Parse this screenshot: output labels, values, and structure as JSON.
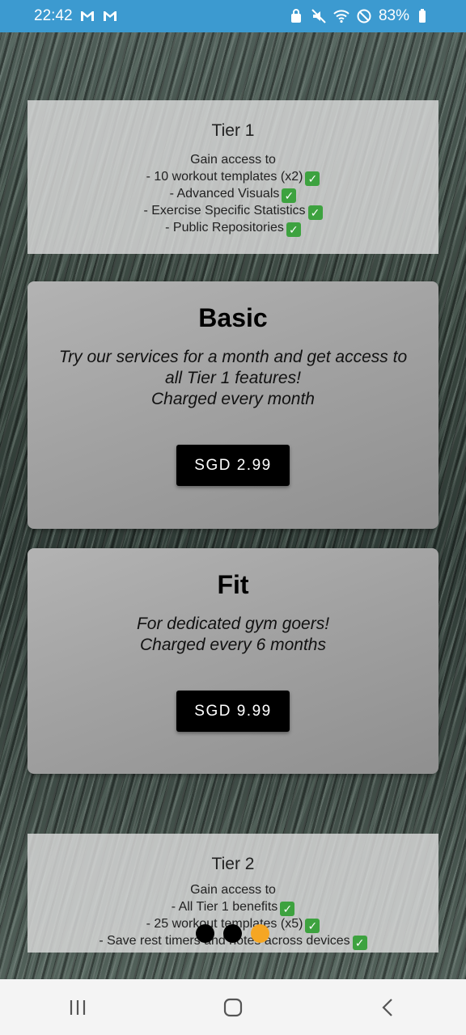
{
  "status_bar": {
    "time": "22:42",
    "battery": "83%",
    "left_icons": [
      "gmail-icon",
      "gmail-icon"
    ],
    "right_icons": [
      "lock-icon",
      "mute-icon",
      "wifi-icon",
      "dnd-icon",
      "battery-icon"
    ]
  },
  "tier1": {
    "title": "Tier 1",
    "lines": [
      "Gain access to",
      "- 10 workout templates (x2)",
      "- Advanced Visuals",
      "- Exercise Specific Statistics",
      "- Public Repositories"
    ]
  },
  "plans": [
    {
      "title": "Basic",
      "desc_lines": [
        "Try our services for a month and get access to",
        "all Tier 1 features!",
        "Charged every month"
      ],
      "price": "SGD 2.99"
    },
    {
      "title": "Fit",
      "desc_lines": [
        "For dedicated gym goers!",
        "Charged every 6 months"
      ],
      "price": "SGD 9.99"
    }
  ],
  "tier2": {
    "title": "Tier 2",
    "lines": [
      "Gain access to",
      "- All Tier 1 benefits",
      "- 25 workout templates (x5)",
      "- Save rest timers and notes across devices"
    ]
  },
  "pager": {
    "count": 3,
    "active_index": 2,
    "active_color": "#f5a623"
  },
  "nav_bar": {
    "icons": [
      "recents-icon",
      "home-icon",
      "back-icon"
    ]
  },
  "colors": {
    "status_bar": "#3c9ad0",
    "button": "#000000"
  }
}
